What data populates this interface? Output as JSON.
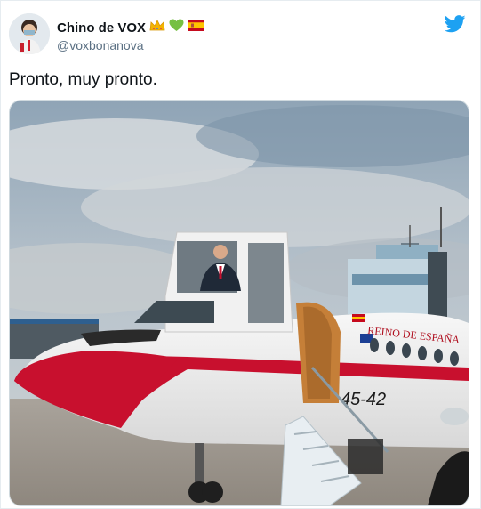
{
  "tweet": {
    "display_name": "Chino de VOX",
    "handle": "@voxbonanova",
    "text": "Pronto, muy pronto.",
    "name_emojis": [
      "crown-emoji",
      "green-heart-emoji",
      "spain-flag-emoji"
    ]
  },
  "media": {
    "plane_livery": "REINO DE ESPAÑA",
    "tail_code": "45-42"
  },
  "colors": {
    "twitter_blue": "#1da1f2",
    "handle_gray": "#5b7083",
    "livery_red": "#c8102e"
  }
}
